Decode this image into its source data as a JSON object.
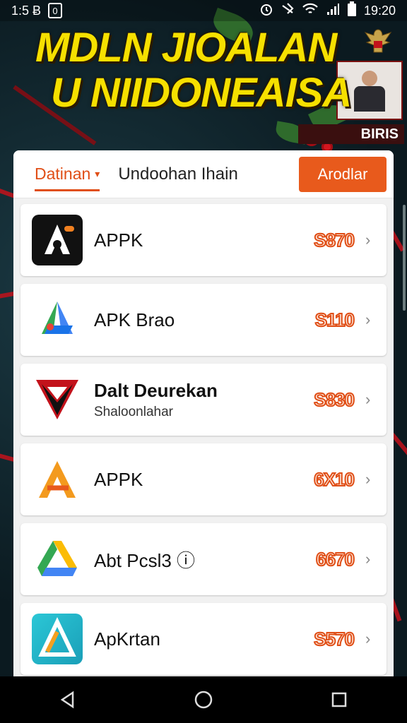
{
  "status_bar": {
    "left_text": "1:5 Ƀ",
    "left_badge": "0",
    "time": "19:20",
    "icons": [
      "alarm-icon",
      "bluetooth-icon",
      "wifi-icon",
      "signal-icon",
      "battery-icon"
    ]
  },
  "banner": {
    "title_line1": "MDLN JIOALAN",
    "title_line2": "U NIIDONEAISA",
    "side_label": "BIRIS"
  },
  "tabs": {
    "active": "Datinan",
    "second": "Undoohan Ihain",
    "button": "Arodlar"
  },
  "apps": [
    {
      "title": "APPK",
      "subtitle": "",
      "price": "S870",
      "icon": "black-a-logo-icon"
    },
    {
      "title": "APK Brao",
      "subtitle": "",
      "price": "S110",
      "icon": "colorful-triangle-icon"
    },
    {
      "title": "Dalt Deurekan",
      "subtitle": "Shaloonlahar",
      "price": "S830",
      "icon": "red-y-logo-icon"
    },
    {
      "title": "APPK",
      "subtitle": "",
      "price": "6X10",
      "icon": "orange-a-logo-icon"
    },
    {
      "title": "Abt Pcsl3 ⓘ",
      "subtitle": "",
      "price": "6670",
      "icon": "drive-triangle-icon"
    },
    {
      "title": "ApKrtan",
      "subtitle": "",
      "price": "S570",
      "icon": "teal-triangle-icon"
    }
  ],
  "colors": {
    "accent": "#e85a1c",
    "banner_text": "#f6e000",
    "background": "#0c1c22"
  },
  "nav": [
    "back-icon",
    "home-icon",
    "recents-icon"
  ]
}
